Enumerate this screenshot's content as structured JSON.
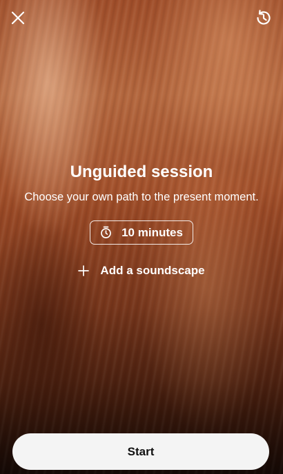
{
  "header": {
    "close_icon": "close-icon",
    "history_icon": "history-icon"
  },
  "session": {
    "title": "Unguided session",
    "subtitle": "Choose your own path to the present moment.",
    "duration_icon": "timer-icon",
    "duration_label": "10 minutes",
    "soundscape_icon": "plus-icon",
    "soundscape_label": "Add a soundscape"
  },
  "footer": {
    "start_label": "Start"
  },
  "colors": {
    "text": "#ffffff",
    "button_bg": "#f4f4f4",
    "button_text": "#111111"
  }
}
